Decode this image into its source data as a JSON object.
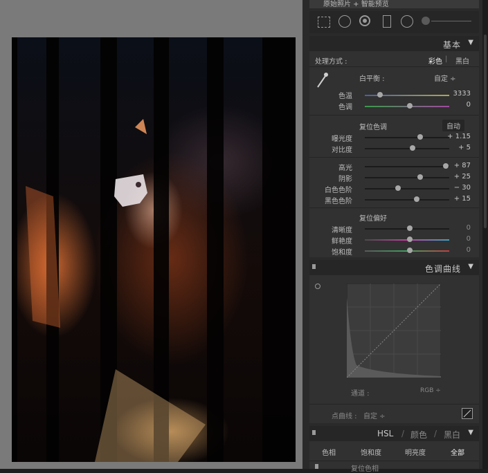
{
  "filmstrip_title": "原始照片 + 智能预览",
  "tools": [
    "grid-crop-icon",
    "spot-removal-icon",
    "red-eye-icon",
    "graduated-filter-icon",
    "radial-filter-icon",
    "brush-icon"
  ],
  "basic": {
    "title": "基本",
    "treatment_label": "处理方式 :",
    "treatment_color": "彩色",
    "treatment_bw": "黑白",
    "wb_label": "白平衡 :",
    "wb_value": "自定 ÷",
    "temp": {
      "label": "色温",
      "value": "3333",
      "pos": 0.18
    },
    "tint": {
      "label": "色调",
      "value": "0",
      "pos": 0.5
    },
    "tone_header": "复位色调",
    "auto": "自动",
    "exposure": {
      "label": "曝光度",
      "value": "+ 1.15",
      "pos": 0.62
    },
    "contrast": {
      "label": "对比度",
      "value": "+ 5",
      "pos": 0.53
    },
    "highlights": {
      "label": "高光",
      "value": "+ 87",
      "pos": 0.93
    },
    "shadows": {
      "label": "阴影",
      "value": "+ 25",
      "pos": 0.62
    },
    "whites": {
      "label": "白色色阶",
      "value": "− 30",
      "pos": 0.36
    },
    "blacks": {
      "label": "黑色色阶",
      "value": "+ 15",
      "pos": 0.58
    },
    "presence_header": "复位偏好",
    "clarity": {
      "label": "清晰度",
      "value": "0",
      "pos": 0.5
    },
    "vibrance": {
      "label": "鲜艳度",
      "value": "0",
      "pos": 0.5
    },
    "saturation": {
      "label": "饱和度",
      "value": "0",
      "pos": 0.5
    }
  },
  "curve": {
    "title": "色调曲线",
    "channel_label": "通道 :",
    "channel_value": "RGB ÷",
    "point_curve_label": "点曲线 :",
    "point_curve_value": "自定 ÷"
  },
  "hsl": {
    "title_hsl": "HSL",
    "title_color": "颜色",
    "title_bw": "黑白",
    "tabs": [
      "色相",
      "饱和度",
      "明亮度",
      "全部"
    ],
    "next_header": "复位色相"
  },
  "colors": {
    "accent": "#dddddd",
    "panel": "#313131",
    "header": "#262626"
  }
}
